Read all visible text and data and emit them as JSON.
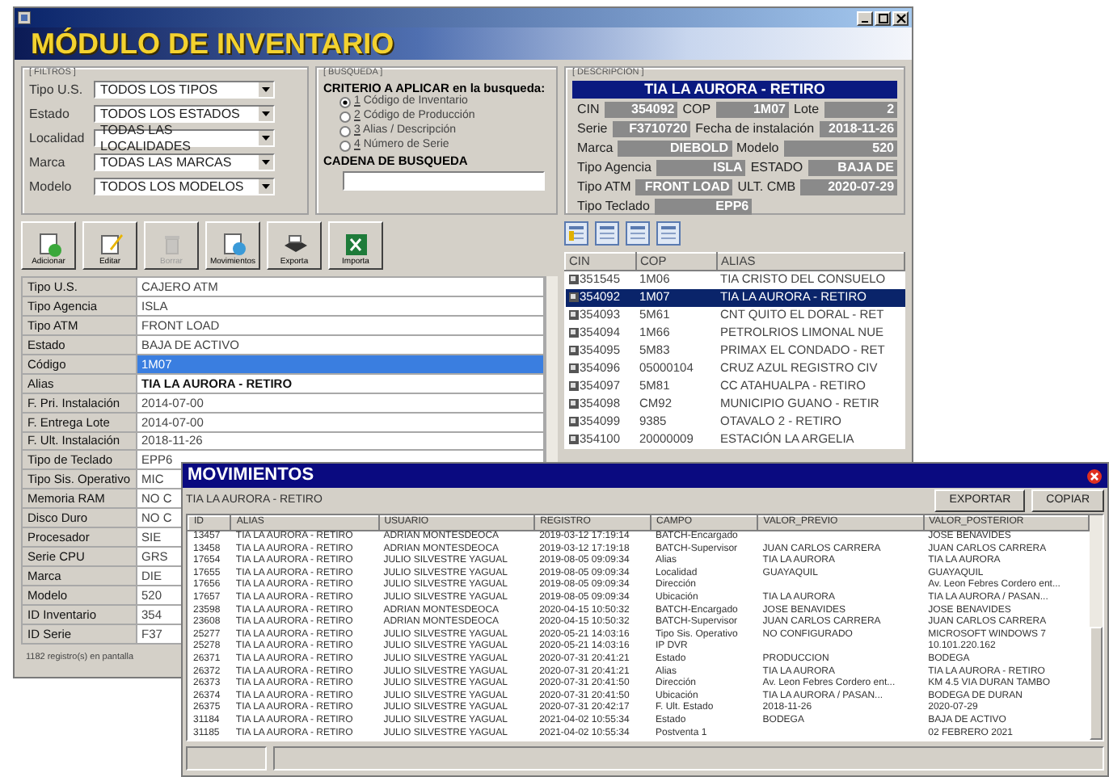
{
  "banner": "MÓDULO DE INVENTARIO",
  "filters": {
    "legend": "[ FILTROS ]",
    "fields": [
      {
        "label": "Tipo U.S.",
        "value": "TODOS LOS TIPOS"
      },
      {
        "label": "Estado",
        "value": "TODOS LOS ESTADOS"
      },
      {
        "label": "Localidad",
        "value": "TODAS LAS LOCALIDADES"
      },
      {
        "label": "Marca",
        "value": "TODAS LAS MARCAS"
      },
      {
        "label": "Modelo",
        "value": "TODOS LOS MODELOS"
      }
    ]
  },
  "search": {
    "legend": "[ BUSQUEDA ]",
    "criteria_label": "CRITERIO A APLICAR en la busqueda:",
    "options": [
      {
        "key": "1",
        "text": "Código de Inventario",
        "selected": true
      },
      {
        "key": "2",
        "text": "Código de Producción",
        "selected": false
      },
      {
        "key": "3",
        "text": "Alias / Descripción",
        "selected": false
      },
      {
        "key": "4",
        "text": "Número de Serie",
        "selected": false
      }
    ],
    "string_label": "CADENA DE BUSQUEDA"
  },
  "description": {
    "legend": "[ DESCRIPCION ]",
    "title": "TIA LA AURORA - RETIRO",
    "rows": [
      [
        {
          "label": "CIN",
          "value": "354092"
        },
        {
          "label": "COP",
          "value": "1M07"
        },
        {
          "label": "Lote",
          "value": "2"
        }
      ],
      [
        {
          "label": "Serie",
          "value": "F3710720"
        },
        {
          "label": "Fecha de instalación",
          "value": "2018-11-26"
        }
      ],
      [
        {
          "label": "Marca",
          "value": "DIEBOLD"
        },
        {
          "label": "Modelo",
          "value": "520"
        }
      ],
      [
        {
          "label": "Tipo Agencia",
          "value": "ISLA"
        },
        {
          "label": "ESTADO",
          "value": "BAJA DE"
        }
      ],
      [
        {
          "label": "Tipo ATM",
          "value": "FRONT LOAD"
        },
        {
          "label": "ULT. CMB",
          "value": "2020-07-29"
        }
      ],
      [
        {
          "label": "Tipo Teclado",
          "value": "EPP6"
        }
      ]
    ]
  },
  "toolbar": [
    {
      "kind": "add",
      "label": "Adicionar",
      "disabled": false
    },
    {
      "kind": "edit",
      "label": "Editar",
      "disabled": false
    },
    {
      "kind": "delete",
      "label": "Borrar",
      "disabled": true
    },
    {
      "kind": "history",
      "label": "Movimientos",
      "disabled": false
    },
    {
      "kind": "print",
      "label": "Exporta",
      "disabled": false
    },
    {
      "kind": "excel",
      "label": "Importa",
      "disabled": false
    }
  ],
  "properties": [
    {
      "name": "Tipo U.S.",
      "value": "CAJERO ATM",
      "selected": false
    },
    {
      "name": "Tipo Agencia",
      "value": "ISLA",
      "selected": false
    },
    {
      "name": "Tipo ATM",
      "value": "FRONT LOAD",
      "selected": false
    },
    {
      "name": "Estado",
      "value": "BAJA DE ACTIVO",
      "selected": false
    },
    {
      "name": "Código",
      "value": "1M07",
      "selected": true
    },
    {
      "name": "Alias",
      "value": "TIA LA AURORA - RETIRO",
      "selected": false
    },
    {
      "name": "F. Pri. Instalación",
      "value": "2014-07-00",
      "selected": false
    },
    {
      "name": "F. Entrega Lote",
      "value": "2014-07-00",
      "selected": false
    },
    {
      "name": "F. Ult. Instalación",
      "value": "2018-11-26",
      "selected": false
    },
    {
      "name": "Tipo de Teclado",
      "value": "EPP6",
      "selected": false
    },
    {
      "name": "Tipo Sis. Operativo",
      "value": "MIC",
      "selected": false
    },
    {
      "name": "Memoria RAM",
      "value": "NO C",
      "selected": false
    },
    {
      "name": "Disco Duro",
      "value": "NO C",
      "selected": false
    },
    {
      "name": "Procesador",
      "value": "SIE",
      "selected": false
    },
    {
      "name": "Serie CPU",
      "value": "GRS",
      "selected": false
    },
    {
      "name": "Marca",
      "value": "DIE",
      "selected": false
    },
    {
      "name": "Modelo",
      "value": "520",
      "selected": false
    },
    {
      "name": "ID Inventario",
      "value": "354",
      "selected": false
    },
    {
      "name": "ID Serie",
      "value": "F37",
      "selected": false
    }
  ],
  "list": {
    "columns": [
      "CIN",
      "COP",
      "ALIAS"
    ],
    "rows": [
      {
        "cin": "351545",
        "cop": "1M06",
        "alias": "TIA CRISTO DEL CONSUELO",
        "selected": false
      },
      {
        "cin": "354092",
        "cop": "1M07",
        "alias": "TIA LA AURORA - RETIRO",
        "selected": true
      },
      {
        "cin": "354093",
        "cop": "5M61",
        "alias": "CNT QUITO EL DORAL - RET",
        "selected": false
      },
      {
        "cin": "354094",
        "cop": "1M66",
        "alias": "PETROLRIOS LIMONAL NUE",
        "selected": false
      },
      {
        "cin": "354095",
        "cop": "5M83",
        "alias": "PRIMAX EL CONDADO - RET",
        "selected": false
      },
      {
        "cin": "354096",
        "cop": "05000104",
        "alias": "CRUZ AZUL REGISTRO CIV",
        "selected": false
      },
      {
        "cin": "354097",
        "cop": "5M81",
        "alias": "CC ATAHUALPA - RETIRO",
        "selected": false
      },
      {
        "cin": "354098",
        "cop": "CM92",
        "alias": "MUNICIPIO GUANO - RETIR",
        "selected": false
      },
      {
        "cin": "354099",
        "cop": "9385",
        "alias": "OTAVALO 2 - RETIRO",
        "selected": false
      },
      {
        "cin": "354100",
        "cop": "20000009",
        "alias": "ESTACIÓN LA ARGELIA",
        "selected": false
      }
    ]
  },
  "status_bar": "1182 registro(s) en pantalla",
  "movements": {
    "title": "MOVIMIENTOS",
    "subtitle": "TIA LA AURORA - RETIRO",
    "buttons": [
      "EXPORTAR",
      "COPIAR"
    ],
    "columns": [
      "ID",
      "ALIAS",
      "USUARIO",
      "REGISTRO",
      "CAMPO",
      "VALOR_PREVIO",
      "VALOR_POSTERIOR"
    ],
    "rows": [
      {
        "id": "13457",
        "alias": "TIA LA AURORA - RETIRO",
        "user": "ADRIAN MONTESDEOCA",
        "registered": "2019-03-12 17:19:14",
        "field": "BATCH-Encargado",
        "next": "JOSE BENAVIDES"
      },
      {
        "id": "13458",
        "alias": "TIA LA AURORA - RETIRO",
        "user": "ADRIAN MONTESDEOCA",
        "registered": "2019-03-12 17:19:18",
        "field": "BATCH-Supervisor",
        "previous": "JUAN CARLOS CARRERA",
        "next": "JUAN CARLOS CARRERA"
      },
      {
        "id": "17654",
        "alias": "TIA LA AURORA - RETIRO",
        "user": "JULIO SILVESTRE YAGUAL",
        "registered": "2019-08-05 09:09:34",
        "field": "Alias",
        "previous": "TIA LA AURORA",
        "next": "TIA LA AURORA"
      },
      {
        "id": "17655",
        "alias": "TIA LA AURORA - RETIRO",
        "user": "JULIO SILVESTRE YAGUAL",
        "registered": "2019-08-05 09:09:34",
        "field": "Localidad",
        "previous": "GUAYAQUIL",
        "next": "GUAYAQUIL"
      },
      {
        "id": "17656",
        "alias": "TIA LA AURORA - RETIRO",
        "user": "JULIO SILVESTRE YAGUAL",
        "registered": "2019-08-05 09:09:34",
        "field": "Dirección",
        "next": "Av. Leon Febres Cordero ent..."
      },
      {
        "id": "17657",
        "alias": "TIA LA AURORA - RETIRO",
        "user": "JULIO SILVESTRE YAGUAL",
        "registered": "2019-08-05 09:09:34",
        "field": "Ubicación",
        "previous": "TIA LA AURORA",
        "next": "TIA LA AURORA / PASAN..."
      },
      {
        "id": "23598",
        "alias": "TIA LA AURORA - RETIRO",
        "user": "ADRIAN MONTESDEOCA",
        "registered": "2020-04-15 10:50:32",
        "field": "BATCH-Encargado",
        "previous": "JOSE BENAVIDES",
        "next": "JOSE BENAVIDES"
      },
      {
        "id": "23608",
        "alias": "TIA LA AURORA - RETIRO",
        "user": "ADRIAN MONTESDEOCA",
        "registered": "2020-04-15 10:50:32",
        "field": "BATCH-Supervisor",
        "previous": "JUAN CARLOS CARRERA",
        "next": "JUAN CARLOS CARRERA"
      },
      {
        "id": "25277",
        "alias": "TIA LA AURORA - RETIRO",
        "user": "JULIO SILVESTRE YAGUAL",
        "registered": "2020-05-21 14:03:16",
        "field": "Tipo Sis. Operativo",
        "previous": "NO CONFIGURADO",
        "next": "MICROSOFT WINDOWS 7"
      },
      {
        "id": "25278",
        "alias": "TIA LA AURORA - RETIRO",
        "user": "JULIO SILVESTRE YAGUAL",
        "registered": "2020-05-21 14:03:16",
        "field": "IP DVR",
        "next": "10.101.220.162"
      },
      {
        "id": "26371",
        "alias": "TIA LA AURORA - RETIRO",
        "user": "JULIO SILVESTRE YAGUAL",
        "registered": "2020-07-31 20:41:21",
        "field": "Estado",
        "previous": "PRODUCCION",
        "next": "BODEGA"
      },
      {
        "id": "26372",
        "alias": "TIA LA AURORA - RETIRO",
        "user": "JULIO SILVESTRE YAGUAL",
        "registered": "2020-07-31 20:41:21",
        "field": "Alias",
        "previous": "TIA LA AURORA",
        "next": "TIA LA AURORA - RETIRO"
      },
      {
        "id": "26373",
        "alias": "TIA LA AURORA - RETIRO",
        "user": "JULIO SILVESTRE YAGUAL",
        "registered": "2020-07-31 20:41:50",
        "field": "Dirección",
        "previous": "Av. Leon Febres Cordero ent...",
        "next": "KM 4.5 VIA DURAN TAMBO"
      },
      {
        "id": "26374",
        "alias": "TIA LA AURORA - RETIRO",
        "user": "JULIO SILVESTRE YAGUAL",
        "registered": "2020-07-31 20:41:50",
        "field": "Ubicación",
        "previous": "TIA LA AURORA / PASAN...",
        "next": "BODEGA DE DURAN"
      },
      {
        "id": "26375",
        "alias": "TIA LA AURORA - RETIRO",
        "user": "JULIO SILVESTRE YAGUAL",
        "registered": "2020-07-31 20:42:17",
        "field": "F. Ult. Estado",
        "previous": "2018-11-26",
        "next": "2020-07-29"
      },
      {
        "id": "31184",
        "alias": "TIA LA AURORA - RETIRO",
        "user": "JULIO SILVESTRE YAGUAL",
        "registered": "2021-04-02 10:55:34",
        "field": "Estado",
        "previous": "BODEGA",
        "next": "BAJA DE ACTIVO"
      },
      {
        "id": "31185",
        "alias": "TIA LA AURORA - RETIRO",
        "user": "JULIO SILVESTRE YAGUAL",
        "registered": "2021-04-02 10:55:34",
        "field": "Postventa 1",
        "next": "02 FEBRERO 2021"
      }
    ]
  }
}
